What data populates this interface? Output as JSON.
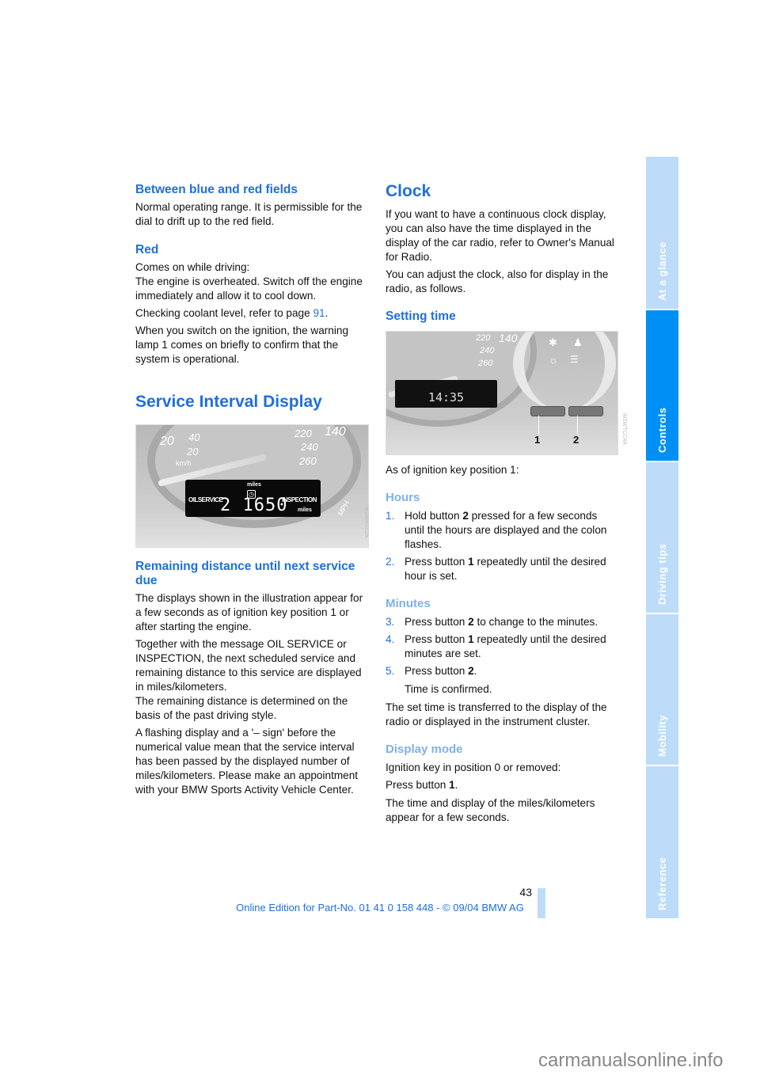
{
  "left": {
    "h_between": "Between blue and red fields",
    "p_between": "Normal operating range. It is permissible for the dial to drift up to the red field.",
    "h_red": "Red",
    "p_red1": "Comes on while driving:",
    "p_red2": "The engine is overheated. Switch off the engine immediately and allow it to cool down.",
    "p_cool_a": "Checking coolant level, refer to page ",
    "p_cool_link": "91",
    "p_cool_b": ".",
    "p_warn": "When you switch on the ignition, the warning lamp 1 comes on briefly to confirm that the system is operational.",
    "h_service": "Service Interval Display",
    "fig_service": {
      "label_miles_top": "miles",
      "label_oil": "OILSERVICE",
      "value": "2 1650",
      "label_insp": "INSPECTION",
      "label_miles": "miles",
      "dial_left": [
        "20",
        "40",
        "20"
      ],
      "unit_kmh": "km/h",
      "dial_right": [
        "220",
        "140",
        "240",
        "260"
      ],
      "unit_mph": "MPH",
      "code": "W2WR1S2A"
    },
    "h_remaining": "Remaining distance until next service due",
    "p_rem1": "The displays shown in the illustration appear for a few seconds as of ignition key position 1 or after starting the engine.",
    "p_rem2": "Together with the message OIL SERVICE or INSPECTION, the next scheduled service and remaining distance to this service are displayed in miles/kilometers.",
    "p_rem3": "The remaining distance is determined on the basis of the past driving style.",
    "p_rem4": "A flashing display and a '– sign' before the numerical value mean that the service interval has been passed by the displayed number of miles/kilometers. Please make an appointment with your BMW Sports Activity Vehicle Center."
  },
  "right": {
    "h_clock": "Clock",
    "p_clock1": "If you want to have a continuous clock display, you can also have the time displayed in the display of the car radio, refer to Owner's Manual for Radio.",
    "p_clock2": "You can adjust the clock, also for display in the radio, as follows.",
    "h_setting": "Setting time",
    "fig_clock": {
      "time": "14:35",
      "dial": [
        "220",
        "140",
        "240",
        "260"
      ],
      "callouts": [
        "1",
        "2"
      ],
      "code": "W2WTCC4A"
    },
    "p_asof": "As of ignition key position 1:",
    "h_hours": "Hours",
    "hours": [
      {
        "n": "1.",
        "a": "Hold button ",
        "b": "2",
        "c": " pressed for a few seconds until the hours are displayed and the colon flashes."
      },
      {
        "n": "2.",
        "a": "Press button ",
        "b": "1",
        "c": " repeatedly until the desired hour is set."
      }
    ],
    "h_minutes": "Minutes",
    "minutes": [
      {
        "n": "3.",
        "a": "Press button ",
        "b": "2",
        "c": " to change to the minutes."
      },
      {
        "n": "4.",
        "a": "Press button ",
        "b": "1",
        "c": " repeatedly until the desired minutes are set."
      },
      {
        "n": "5.",
        "a": "Press button ",
        "b": "2",
        "c": "."
      }
    ],
    "p_confirmed": "Time is confirmed.",
    "p_transfer": "The set time is transferred to the display of the radio or displayed in the instrument cluster.",
    "h_display": "Display mode",
    "p_dm1": "Ignition key in position 0 or removed:",
    "p_dm2a": "Press button ",
    "p_dm2b": "1",
    "p_dm2c": ".",
    "p_dm3": "The time and display of the miles/kilometers appear for a few seconds."
  },
  "sidebar": {
    "tabs": [
      "At a glance",
      "Controls",
      "Driving tips",
      "Mobility",
      "Reference"
    ],
    "active": "Controls",
    "colors": {
      "active": "#0090f5",
      "inactive": "#bddcfa"
    }
  },
  "footer": {
    "page": "43",
    "edition": "Online Edition for Part-No. 01 41 0 158 448 - © 09/04 BMW AG"
  },
  "watermark": "carmanualsonline.info"
}
